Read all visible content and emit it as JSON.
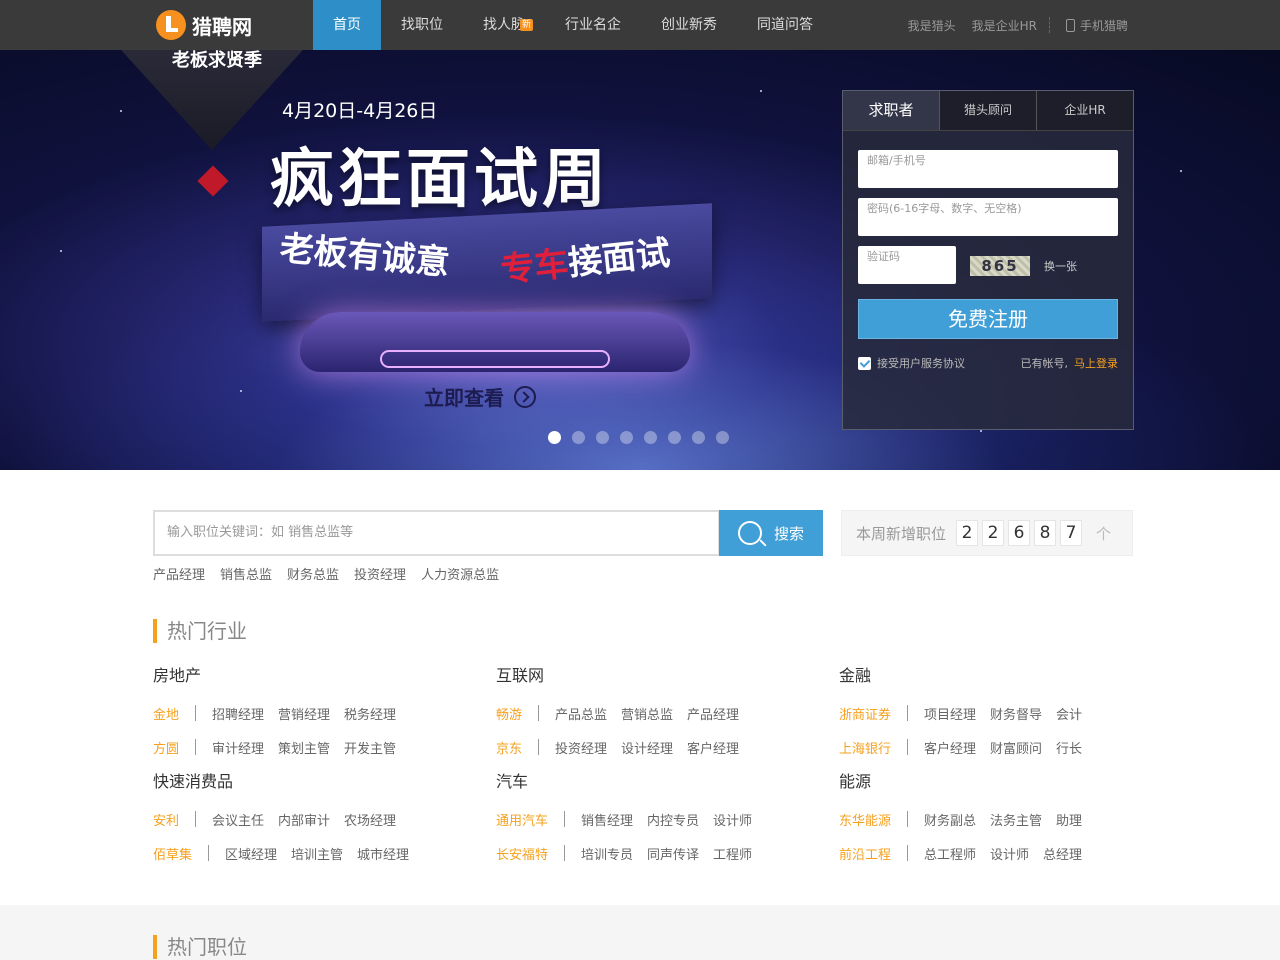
{
  "header": {
    "logo_text": "猎聘网",
    "nav": [
      {
        "label": "首页",
        "active": true
      },
      {
        "label": "找职位"
      },
      {
        "label": "找人脉",
        "badge": "新"
      },
      {
        "label": "行业名企"
      },
      {
        "label": "创业新秀"
      },
      {
        "label": "同道问答"
      }
    ],
    "links": {
      "headhunter": "我是猎头",
      "hr": "我是企业HR",
      "mobile": "手机猎聘"
    }
  },
  "banner": {
    "ribbon_text": "老板求贤季",
    "date": "4月20日-4月26日",
    "title": "疯狂面试周",
    "sub1": "老板有诚意",
    "sub2_red": "专车",
    "sub2_rest": "接面试",
    "cta": "立即查看",
    "dots": 8,
    "active_dot": 0
  },
  "login": {
    "tabs": [
      "求职者",
      "猎头顾问",
      "企业HR"
    ],
    "active_tab": 0,
    "email_placeholder": "邮箱/手机号",
    "password_placeholder": "密码(6-16字母、数字、无空格)",
    "captcha_placeholder": "验证码",
    "captcha_text": "865",
    "refresh": "换一张",
    "register": "免费注册",
    "agree": "接受用户服务协议",
    "has_account": "已有帐号,",
    "login_link": "马上登录"
  },
  "search": {
    "placeholder": "输入职位关键词：如 销售总监等",
    "button": "搜索",
    "hot": [
      "产品经理",
      "销售总监",
      "财务总监",
      "投资经理",
      "人力资源总监"
    ]
  },
  "stats": {
    "label": "本周新增职位",
    "digits": [
      "2",
      "2",
      "6",
      "8",
      "7"
    ],
    "unit": "个"
  },
  "hot_industry": {
    "title": "热门行业",
    "groups": [
      {
        "name": "房地产",
        "rows": [
          {
            "company": "金地",
            "jobs": [
              "招聘经理",
              "营销经理",
              "税务经理"
            ]
          },
          {
            "company": "方圆",
            "jobs": [
              "审计经理",
              "策划主管",
              "开发主管"
            ]
          }
        ]
      },
      {
        "name": "互联网",
        "rows": [
          {
            "company": "畅游",
            "jobs": [
              "产品总监",
              "营销总监",
              "产品经理"
            ]
          },
          {
            "company": "京东",
            "jobs": [
              "投资经理",
              "设计经理",
              "客户经理"
            ]
          }
        ]
      },
      {
        "name": "金融",
        "rows": [
          {
            "company": "浙商证券",
            "jobs": [
              "项目经理",
              "财务督导",
              "会计"
            ]
          },
          {
            "company": "上海银行",
            "jobs": [
              "客户经理",
              "财富顾问",
              "行长"
            ]
          }
        ]
      },
      {
        "name": "快速消费品",
        "rows": [
          {
            "company": "安利",
            "jobs": [
              "会议主任",
              "内部审计",
              "农场经理"
            ]
          },
          {
            "company": "佰草集",
            "jobs": [
              "区域经理",
              "培训主管",
              "城市经理"
            ]
          }
        ]
      },
      {
        "name": "汽车",
        "rows": [
          {
            "company": "通用汽车",
            "jobs": [
              "销售经理",
              "内控专员",
              "设计师"
            ]
          },
          {
            "company": "长安福特",
            "jobs": [
              "培训专员",
              "同声传译",
              "工程师"
            ]
          }
        ]
      },
      {
        "name": "能源",
        "rows": [
          {
            "company": "东华能源",
            "jobs": [
              "财务副总",
              "法务主管",
              "助理"
            ]
          },
          {
            "company": "前沿工程",
            "jobs": [
              "总工程师",
              "设计师",
              "总经理"
            ]
          }
        ]
      }
    ]
  },
  "hot_jobs": {
    "title": "热门职位"
  },
  "colors": {
    "accent": "#3f9fd6",
    "orange": "#f6a11e",
    "nav_bg": "#3a3a3a"
  }
}
